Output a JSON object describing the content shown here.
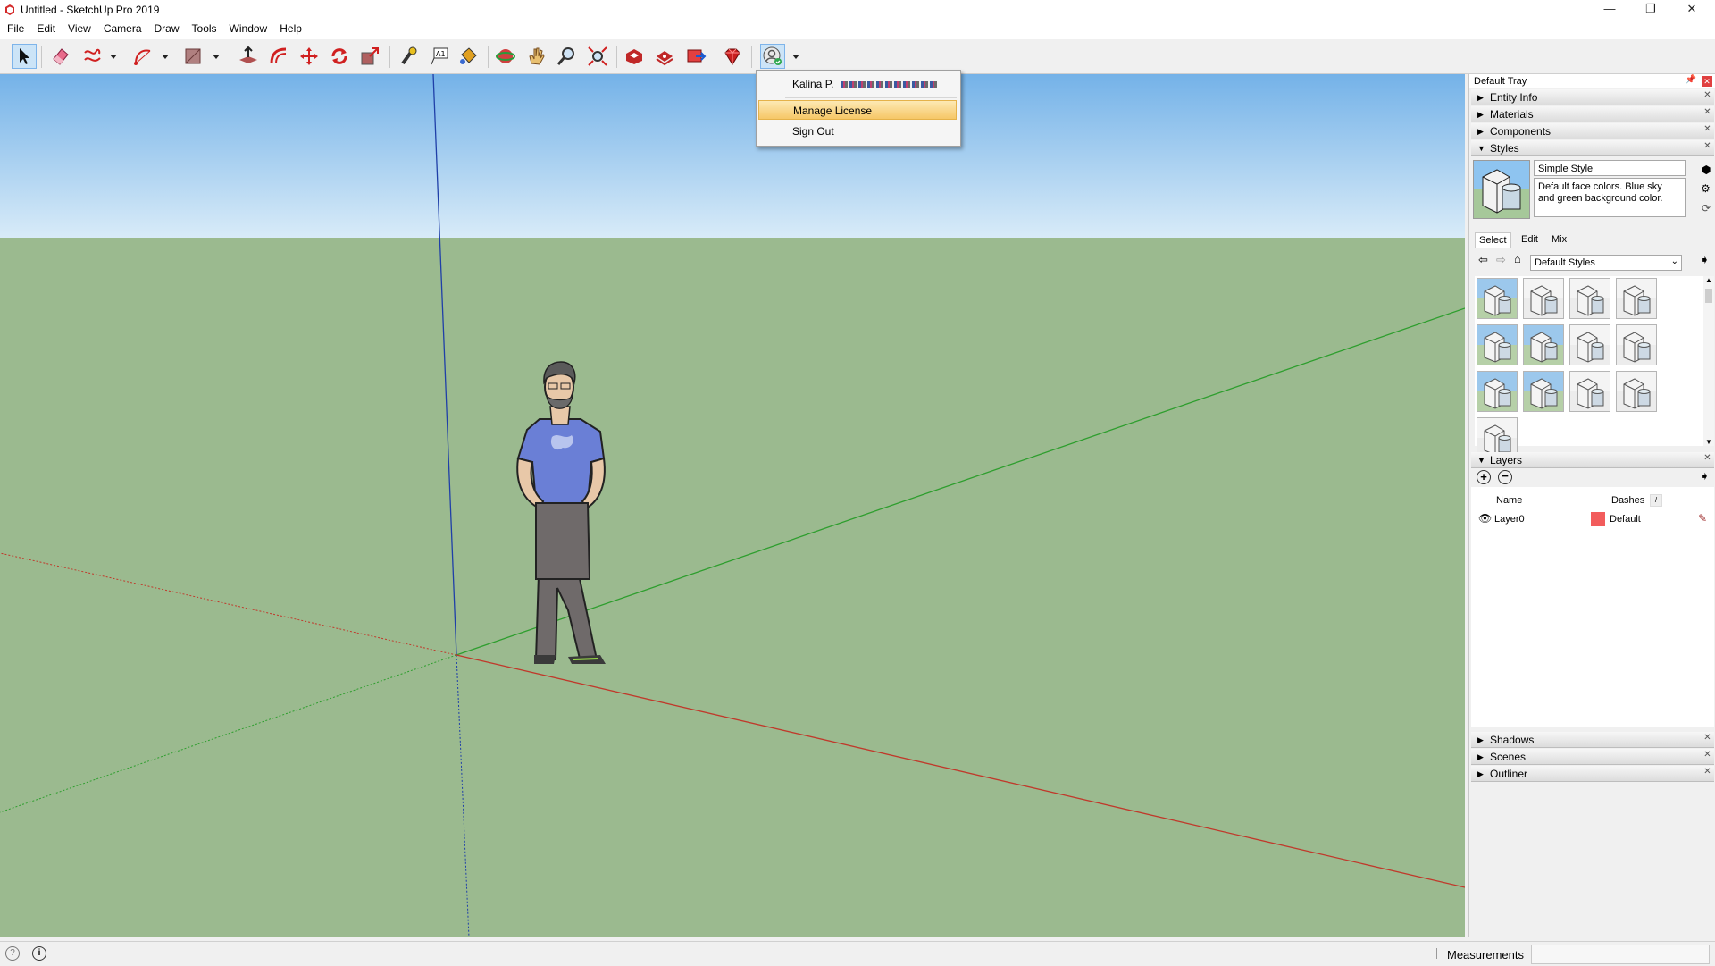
{
  "window": {
    "title": "Untitled - SketchUp Pro 2019",
    "controls": {
      "minimize": "—",
      "restore": "❐",
      "close": "✕"
    }
  },
  "menu": [
    "File",
    "Edit",
    "View",
    "Camera",
    "Draw",
    "Tools",
    "Window",
    "Help"
  ],
  "toolbar": {
    "tools": [
      "select",
      "eraser",
      "freehand",
      "arc",
      "rectangle",
      "push-pull",
      "offset",
      "move",
      "rotate",
      "scale",
      "tape-measure",
      "text",
      "paint-bucket",
      "orbit",
      "pan",
      "zoom",
      "zoom-extents",
      "3d-warehouse",
      "extension-warehouse",
      "layout",
      "extension-manager",
      "account"
    ]
  },
  "account_menu": {
    "user": "Kalina P.",
    "items": [
      "Manage License",
      "Sign Out"
    ],
    "highlighted": "Manage License"
  },
  "tray": {
    "title": "Default Tray",
    "collapsed_panels_top": [
      "Entity Info",
      "Materials",
      "Components"
    ],
    "styles": {
      "header": "Styles",
      "style_name": "Simple Style",
      "description": "Default face colors. Blue sky and green background color.",
      "tabs": [
        "Select",
        "Edit",
        "Mix"
      ],
      "active_tab": "Select",
      "collection": "Default Styles",
      "thumbnail_count": 13
    },
    "layers": {
      "header": "Layers",
      "columns": {
        "name": "Name",
        "dashes": "Dashes"
      },
      "rows": [
        {
          "name": "Layer0",
          "color": "#f25c5c",
          "dashes": "Default"
        }
      ]
    },
    "collapsed_panels_bottom": [
      "Shadows",
      "Scenes",
      "Outliner"
    ]
  },
  "status": {
    "measurements_label": "Measurements",
    "measurements_value": ""
  },
  "colors": {
    "sky": "#78b6ea",
    "ground": "#9bba8f",
    "axis_red": "#c0392b",
    "axis_green": "#2e9e2e",
    "axis_blue": "#1f3fa8",
    "menu_highlight": "#f8d27a"
  }
}
